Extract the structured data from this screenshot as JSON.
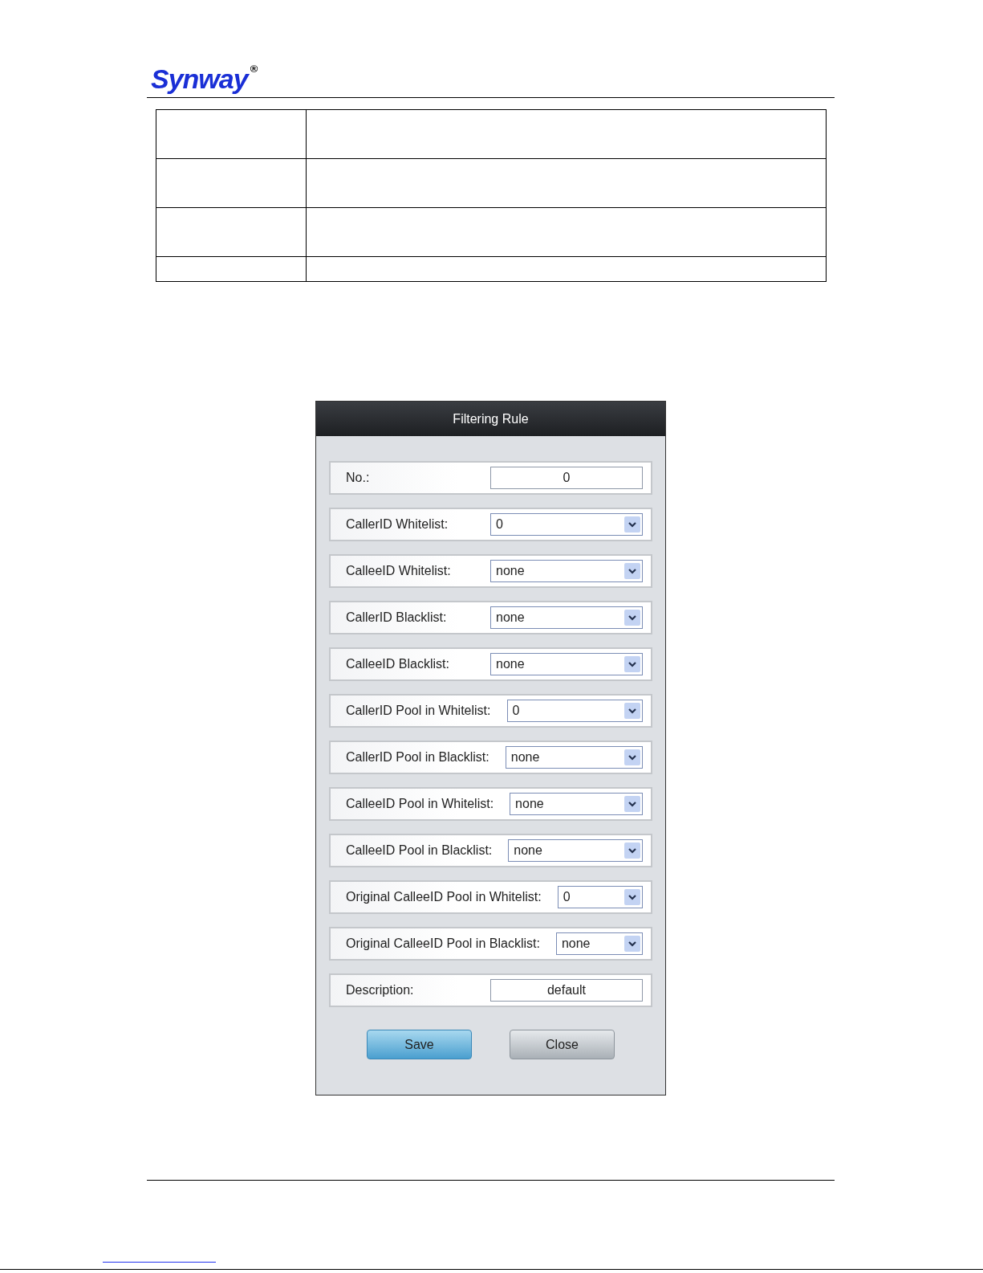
{
  "header": {
    "logo": "Synway",
    "logo_mark": "®"
  },
  "dialog": {
    "title": "Filtering Rule",
    "fields": [
      {
        "kind": "text",
        "label": "No.:",
        "value": "0"
      },
      {
        "kind": "select",
        "label": "CallerID Whitelist:",
        "value": "0"
      },
      {
        "kind": "select",
        "label": "CalleeID Whitelist:",
        "value": "none"
      },
      {
        "kind": "select",
        "label": "CallerID Blacklist:",
        "value": "none"
      },
      {
        "kind": "select",
        "label": "CalleeID Blacklist:",
        "value": "none"
      },
      {
        "kind": "select",
        "label": "CallerID Pool in Whitelist:",
        "value": "0"
      },
      {
        "kind": "select",
        "label": "CallerID Pool in Blacklist:",
        "value": "none"
      },
      {
        "kind": "select",
        "label": "CalleeID Pool in Whitelist:",
        "value": "none"
      },
      {
        "kind": "select",
        "label": "CalleeID Pool in Blacklist:",
        "value": "none"
      },
      {
        "kind": "select",
        "label": "Original CalleeID Pool in Whitelist:",
        "value": "0"
      },
      {
        "kind": "select",
        "label": "Original CalleeID Pool in Blacklist:",
        "value": "none"
      },
      {
        "kind": "text",
        "label": "Description:",
        "value": "default"
      }
    ],
    "buttons": [
      {
        "kind": "primary",
        "label": "Save"
      },
      {
        "kind": "secondary",
        "label": "Close"
      }
    ]
  }
}
